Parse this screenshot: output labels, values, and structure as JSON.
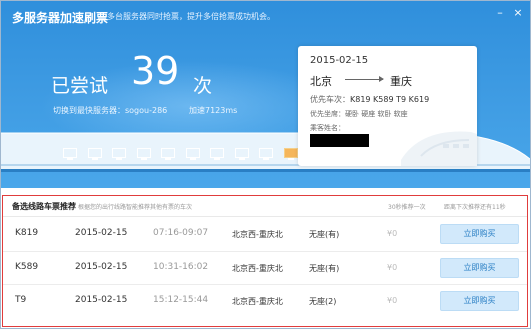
{
  "header": {
    "title": "多服务器加速刷票",
    "subtitle": "多台服务器同时抢票，提升多倍抢票成功机会。",
    "attempt_prefix": "已尝试",
    "attempt_count": "39",
    "attempt_suffix": "次",
    "switch_text": "切换到最快服务器：sogou-286",
    "speed_text": "加速7123ms",
    "servers_total": 10,
    "servers_active_index": 9
  },
  "ticket": {
    "date": "2015-02-15",
    "from": "北京",
    "to": "重庆",
    "trains_label": "优先车次：",
    "trains": "K819   K589   T9   K619",
    "seats": "优先坐席：硬卧   硬座   软卧   软座",
    "rider_label": "乘客姓名：",
    "rider_redacted": true
  },
  "alternatives": {
    "title": "备选线路车票推荐",
    "subtitle": "根据您的出行线路智能推荐其他有票的车次",
    "refresh_info": "30秒推荐一次",
    "next_info": "距离下次推荐还有11秒",
    "buy_label": "立即购买",
    "rows": [
      {
        "train": "K819",
        "date": "2015-02-15",
        "time": "07:16-09:07",
        "route": "北京西-重庆北",
        "seat": "无座(有)",
        "price": "¥0"
      },
      {
        "train": "K589",
        "date": "2015-02-15",
        "time": "10:31-16:02",
        "route": "北京西-重庆北",
        "seat": "无座(有)",
        "price": "¥0"
      },
      {
        "train": "T9",
        "date": "2015-02-15",
        "time": "15:12-15:44",
        "route": "北京西-重庆北",
        "seat": "无座(2)",
        "price": "¥0"
      }
    ]
  },
  "colors": {
    "header_blue": "#3d9ae2",
    "highlight_border": "#e03c3c",
    "button_bg": "#d2e9fb",
    "active_server": "#f5b65b"
  }
}
